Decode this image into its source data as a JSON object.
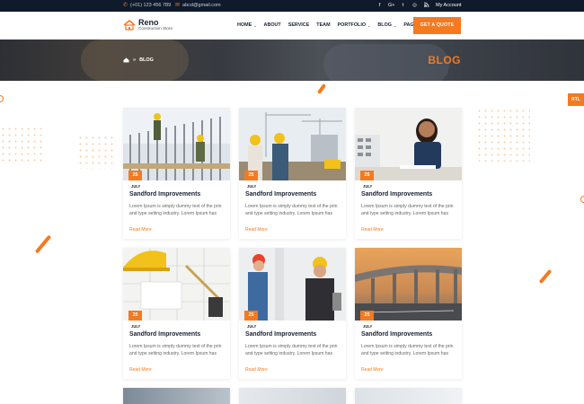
{
  "topbar": {
    "phone": "(+01) 123 456 789",
    "email": "abcd@gmail.com",
    "social_icons": [
      "facebook-icon",
      "google-plus-icon",
      "twitter-icon",
      "instagram-icon",
      "rss-icon"
    ],
    "social_glyphs": [
      "f",
      "G+",
      "t",
      "◎",
      "◡"
    ],
    "account": "My Account"
  },
  "header": {
    "logo_name": "Reno",
    "logo_sub": "Construction Store",
    "nav": [
      {
        "label": "HOME",
        "has_dropdown": true
      },
      {
        "label": "ABOUT",
        "has_dropdown": false
      },
      {
        "label": "SERVICE",
        "has_dropdown": false
      },
      {
        "label": "TEAM",
        "has_dropdown": false
      },
      {
        "label": "PORTFOLIO",
        "has_dropdown": true
      },
      {
        "label": "BLOG",
        "has_dropdown": true
      },
      {
        "label": "PAGE",
        "has_dropdown": true
      }
    ],
    "cta": "GET A QUOTE"
  },
  "banner": {
    "breadcrumb_home_icon": "home-icon",
    "breadcrumb_sep": "»",
    "breadcrumb_current": "BLOG",
    "title": "BLOG"
  },
  "rtl_button": "RTL",
  "posts": [
    {
      "day": "25",
      "month": "JULY",
      "title": "Sandford Improvements",
      "excerpt": "Lorem Ipsum is simply dummy text of the prin and type setting industry. Lorem Ipsum has",
      "read_more": "Read More"
    },
    {
      "day": "25",
      "month": "JULY",
      "title": "Sandford Improvements",
      "excerpt": "Lorem Ipsum is simply dummy text of the prin and type setting industry. Lorem Ipsum has",
      "read_more": "Read More"
    },
    {
      "day": "25",
      "month": "JULY",
      "title": "Sandford Improvements",
      "excerpt": "Lorem Ipsum is simply dummy text of the prin and type setting industry. Lorem Ipsum has",
      "read_more": "Read More"
    },
    {
      "day": "25",
      "month": "JULY",
      "title": "Sandford Improvements",
      "excerpt": "Lorem Ipsum is simply dummy text of the prin and type setting industry. Lorem Ipsum has",
      "read_more": "Read More"
    },
    {
      "day": "25",
      "month": "JULY",
      "title": "Sandford Improvements",
      "excerpt": "Lorem Ipsum is simply dummy text of the prin and type setting industry. Lorem Ipsum has",
      "read_more": "Read More"
    },
    {
      "day": "25",
      "month": "JULY",
      "title": "Sandford Improvements",
      "excerpt": "Lorem Ipsum is simply dummy text of the prin and type setting industry. Lorem Ipsum has",
      "read_more": "Read More"
    }
  ],
  "colors": {
    "accent": "#f47a20",
    "dark": "#0f1a2b",
    "heading": "#1a2233"
  }
}
